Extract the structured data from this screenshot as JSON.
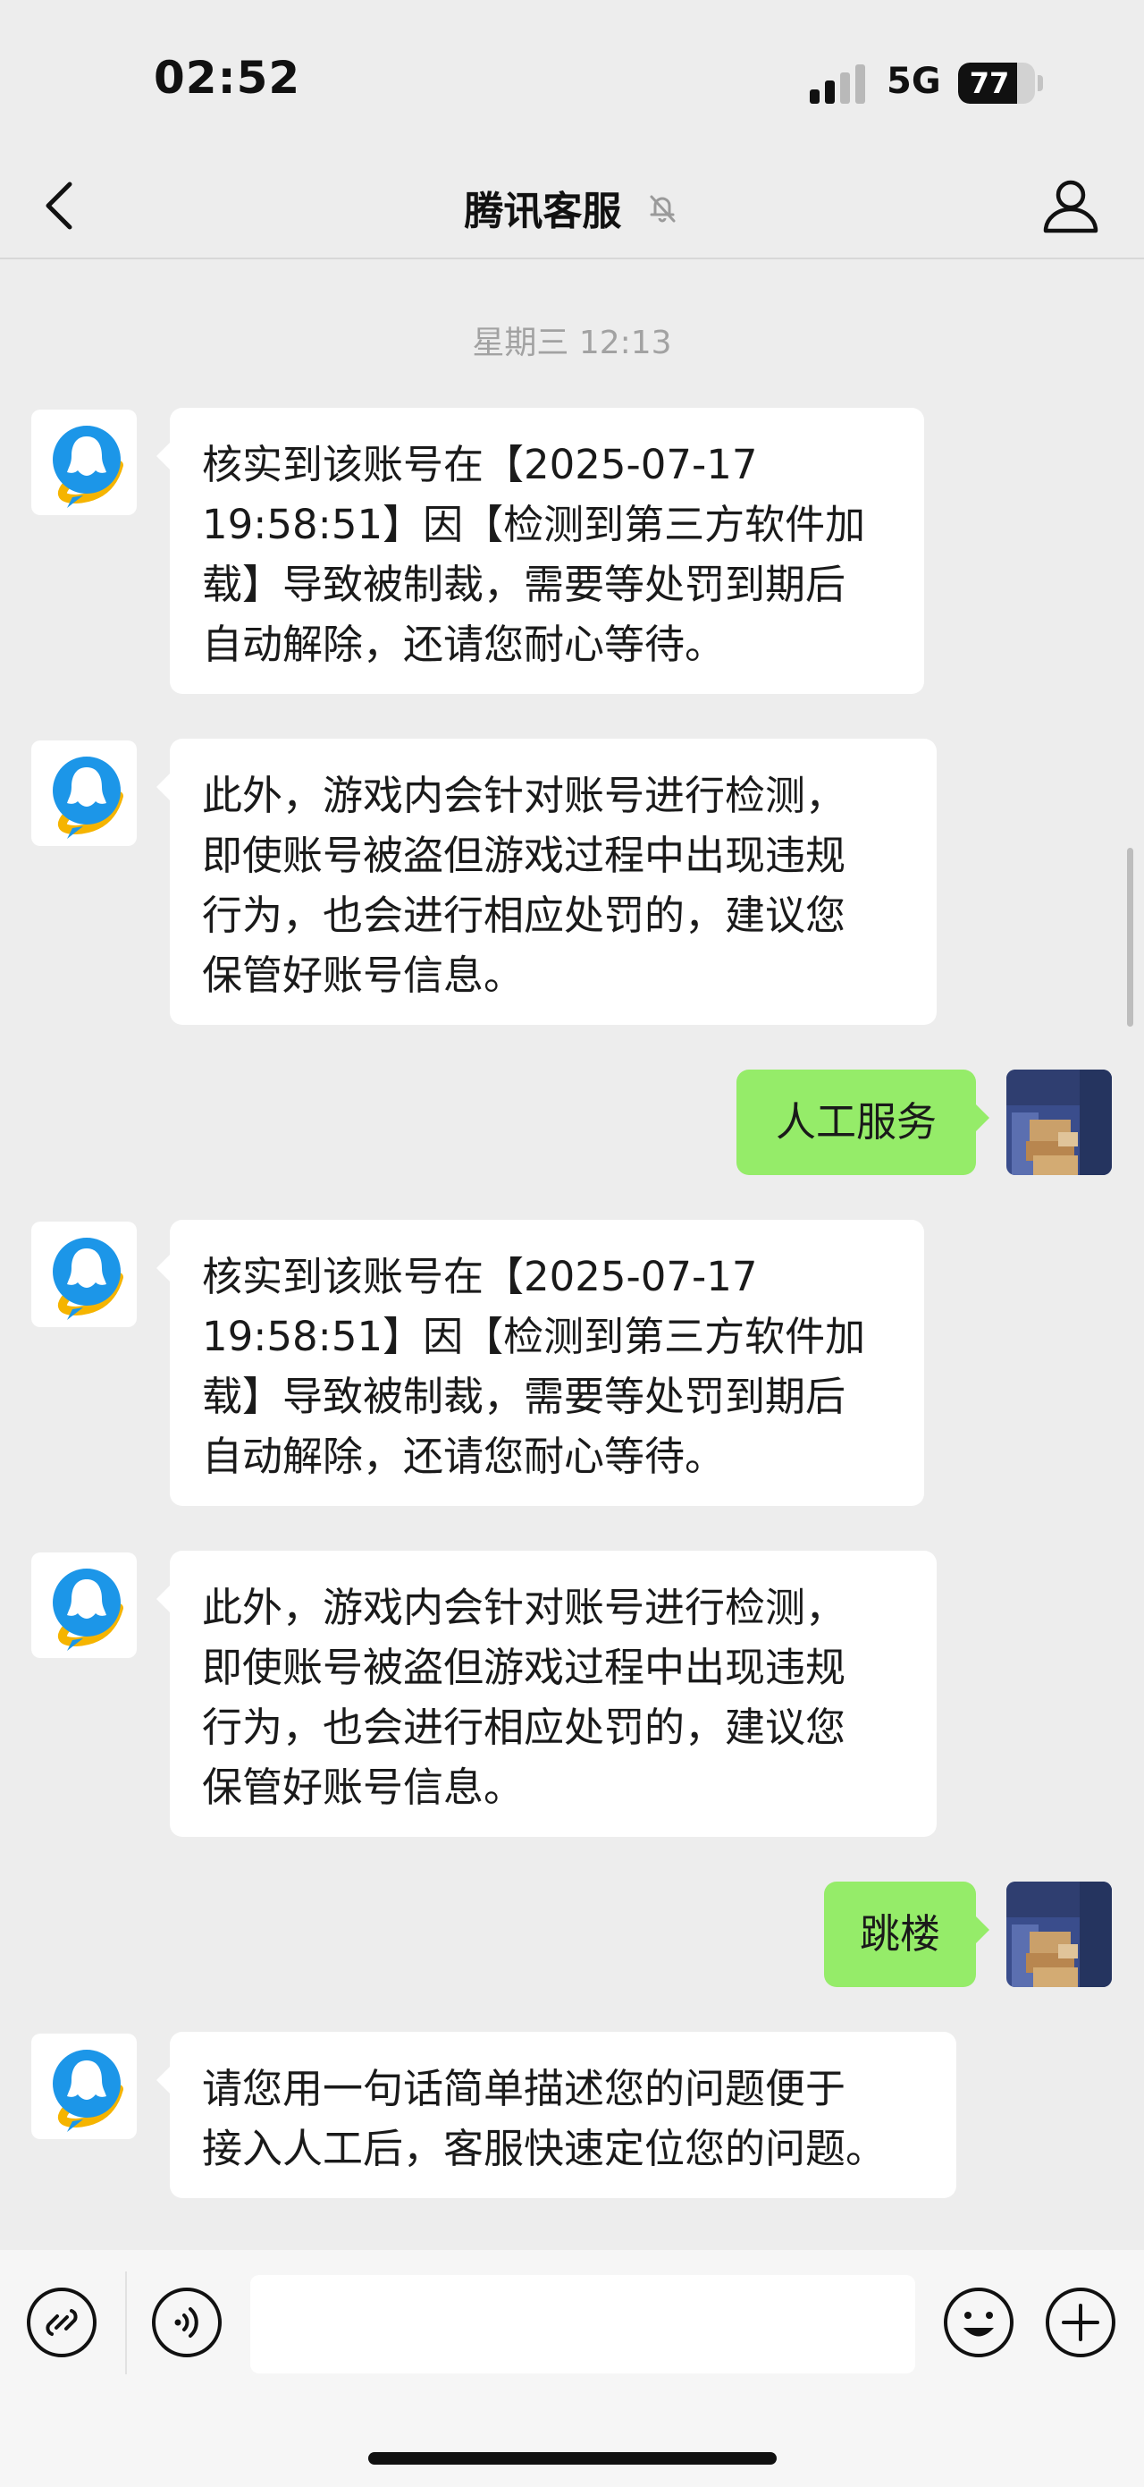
{
  "status_bar": {
    "time": "02:52",
    "network": "5G",
    "battery": "77",
    "battery_level": 0.77
  },
  "nav": {
    "title": "腾讯客服"
  },
  "chat": {
    "timestamp": "星期三 12:13",
    "messages": [
      {
        "sender": "bot",
        "lines": [
          "核实到该账号在【2025-07-17",
          "19:58:51】因【检测到第三方软件加",
          "载】导致被制裁，需要等处罚到期后",
          "自动解除，还请您耐心等待。"
        ]
      },
      {
        "sender": "bot",
        "lines": [
          "此外，游戏内会针对账号进行检测，",
          "即使账号被盗但游戏过程中出现违规",
          "行为，也会进行相应处罚的，建议您",
          "保管好账号信息。"
        ]
      },
      {
        "sender": "me",
        "text": "人工服务"
      },
      {
        "sender": "bot",
        "lines": [
          "核实到该账号在【2025-07-17",
          "19:58:51】因【检测到第三方软件加",
          "载】导致被制裁，需要等处罚到期后",
          "自动解除，还请您耐心等待。"
        ]
      },
      {
        "sender": "bot",
        "lines": [
          "此外，游戏内会针对账号进行检测，",
          "即使账号被盗但游戏过程中出现违规",
          "行为，也会进行相应处罚的，建议您",
          "保管好账号信息。"
        ]
      },
      {
        "sender": "me",
        "text": "跳楼"
      },
      {
        "sender": "bot",
        "lines": [
          "请您用一句话简单描述您的问题便于",
          "接入人工后，客服快速定位您的问题。"
        ]
      }
    ]
  },
  "input_bar": {
    "placeholder": ""
  },
  "icons": {
    "back": "chevron-left-icon",
    "mute": "bell-off-icon",
    "profile": "person-icon",
    "mini_program": "link-icon",
    "voice": "voice-icon",
    "emoji": "smile-icon",
    "more": "plus-icon"
  },
  "colors": {
    "background": "#ededed",
    "my_bubble": "#95ec69",
    "bot_bubble": "#ffffff",
    "bot_logo": "#1c96e8",
    "bot_logo_accent": "#f5b400"
  }
}
